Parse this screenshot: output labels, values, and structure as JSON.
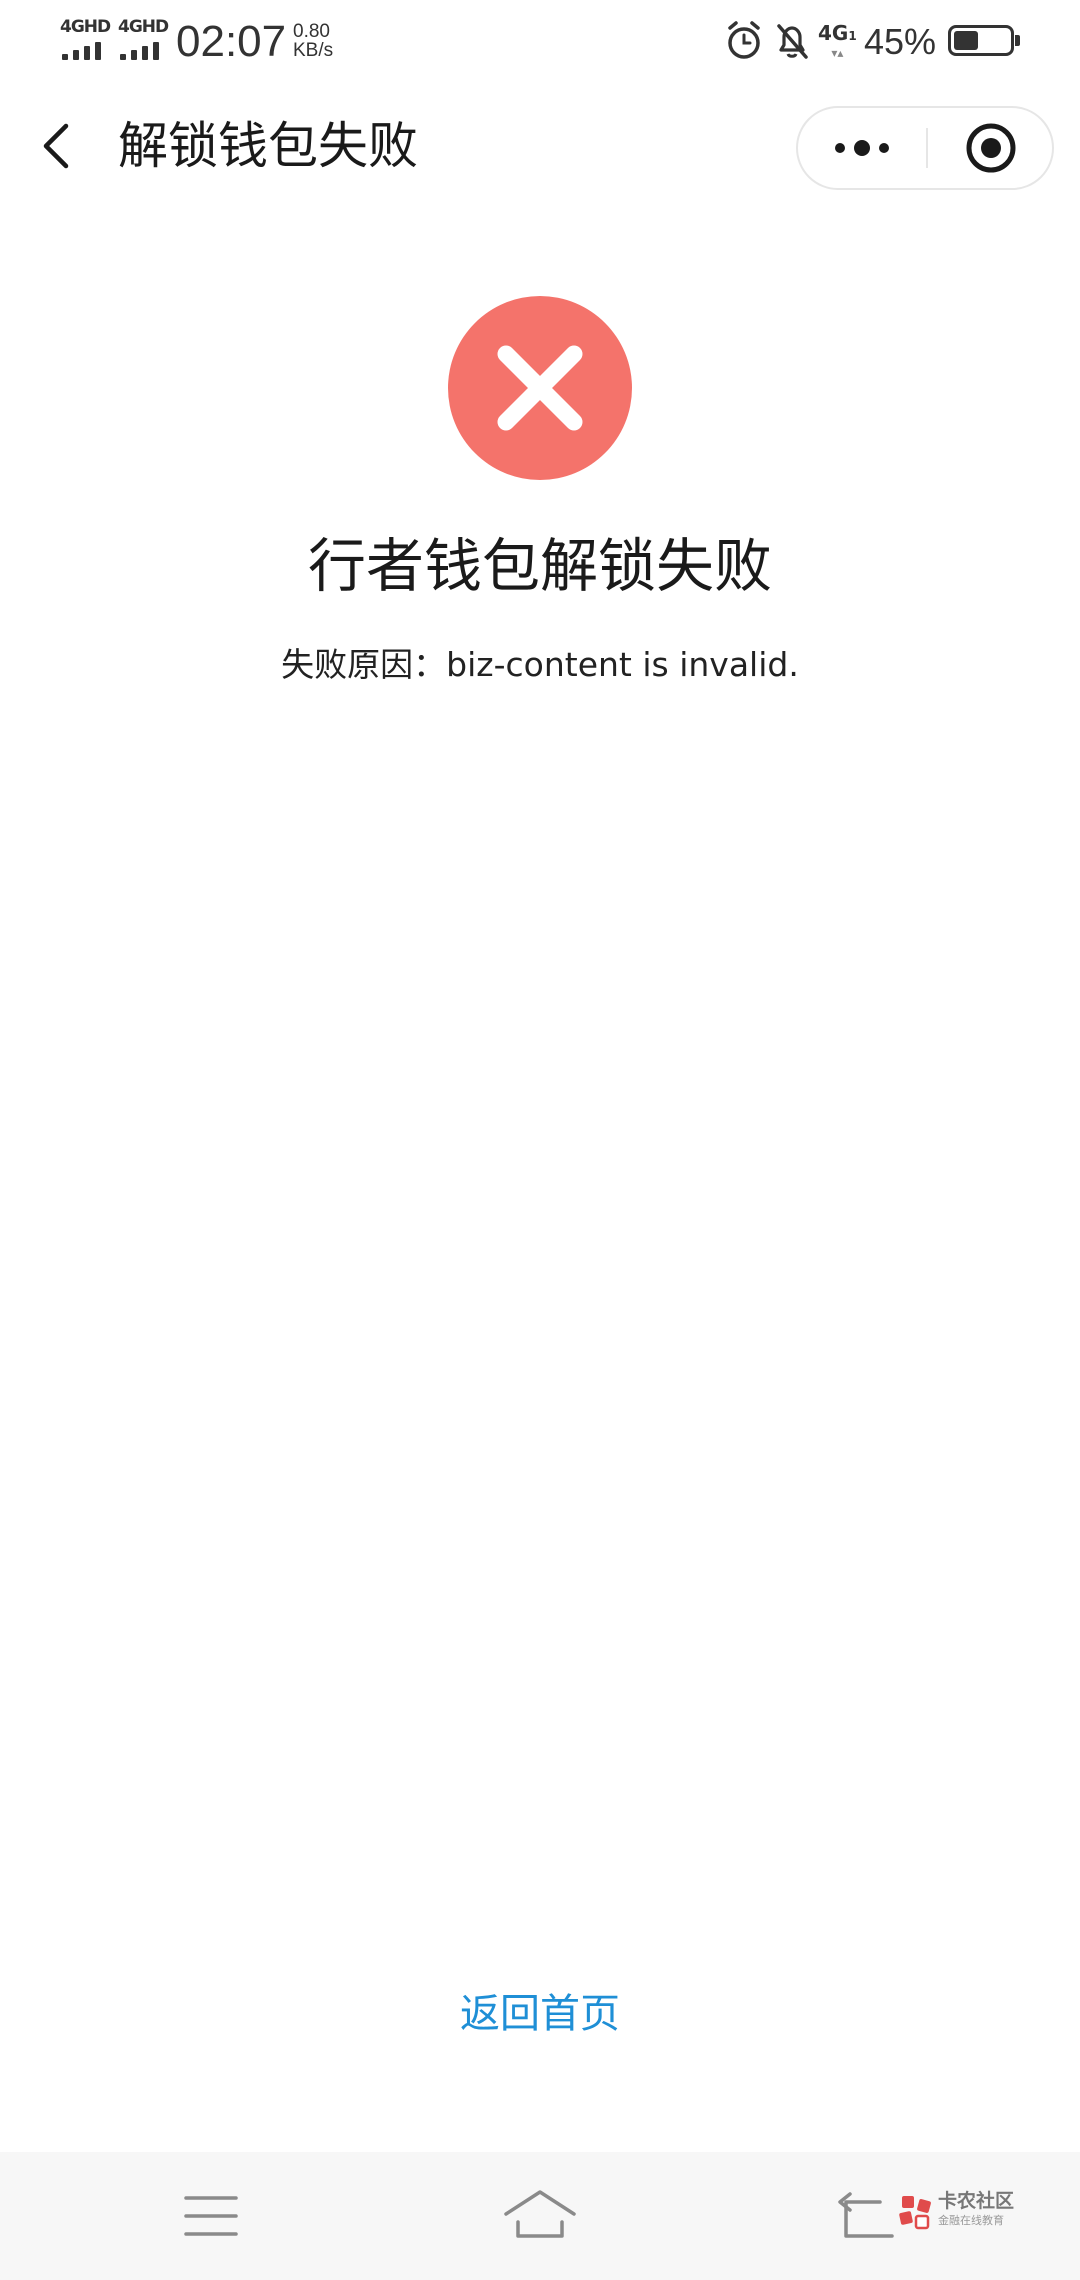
{
  "status_bar": {
    "network_1": "4GHD",
    "network_2": "4GHD",
    "time": "02:07",
    "speed_value": "0.80",
    "speed_unit": "KB/s",
    "mobile_network": "4G",
    "battery_percent": "45%",
    "battery_level": 0.45,
    "icons": [
      "alarm-icon",
      "bell-off-icon",
      "battery-icon",
      "signal-icon"
    ]
  },
  "title_bar": {
    "title": "解锁钱包失败",
    "icons": [
      "back-arrow-icon",
      "more-dots-icon",
      "mini-program-close-icon"
    ]
  },
  "result": {
    "status": "error",
    "icon": "error-x-icon",
    "title": "行者钱包解锁失败",
    "reason_label": "失败原因：",
    "reason_value": "biz-content is invalid."
  },
  "actions": {
    "home_link": "返回首页"
  },
  "nav_bar": {
    "icons": [
      "menu-icon",
      "home-icon",
      "back-icon"
    ]
  },
  "watermark": {
    "main": "卡农社区",
    "sub": "金融在线教育"
  },
  "colors": {
    "error": "#f4736b",
    "link": "#1f8fd6",
    "text": "#1a1a1a",
    "nav_background": "#f7f7f7"
  }
}
